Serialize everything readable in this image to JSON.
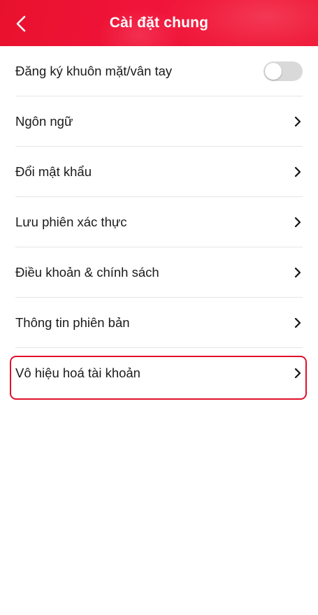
{
  "header": {
    "title": "Cài đặt chung",
    "back_icon": "chevron-left-icon",
    "background_color": "#ec1736"
  },
  "settings": {
    "items": [
      {
        "label": "Đăng ký khuôn mặt/vân tay",
        "control": "toggle",
        "toggle_on": false
      },
      {
        "label": "Ngôn ngữ",
        "control": "chevron-right-icon"
      },
      {
        "label": "Đổi mật khẩu",
        "control": "chevron-right-icon"
      },
      {
        "label": "Lưu phiên xác thực",
        "control": "chevron-right-icon"
      },
      {
        "label": "Điều khoản & chính sách",
        "control": "chevron-right-icon"
      },
      {
        "label": "Thông tin phiên bản",
        "control": "chevron-right-icon"
      },
      {
        "label": "Vô hiệu hoá tài khoản",
        "control": "chevron-right-icon",
        "highlighted": true
      }
    ]
  },
  "colors": {
    "accent": "#ec1736",
    "highlight_border": "#e0102b",
    "toggle_off": "#d9d9d9",
    "divider": "#e6e6e6"
  }
}
